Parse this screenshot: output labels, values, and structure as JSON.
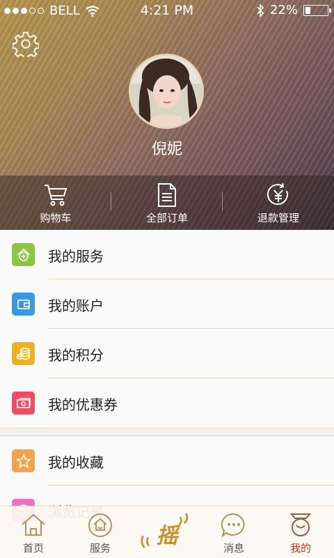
{
  "status_bar": {
    "carrier": "BELL",
    "time": "4:21 PM",
    "battery": "22%",
    "battery_level": 0.22
  },
  "profile": {
    "name": "倪妮"
  },
  "quick_actions": [
    {
      "label": "购物车",
      "icon": "cart-icon"
    },
    {
      "label": "全部订单",
      "icon": "order-list-icon"
    },
    {
      "label": "退款管理",
      "icon": "refund-yen-icon"
    }
  ],
  "menu": {
    "items": [
      {
        "label": "我的服务",
        "icon": "house-service-icon",
        "color": "#8cc63f"
      },
      {
        "label": "我的账户",
        "icon": "wallet-icon",
        "color": "#3a98e0"
      },
      {
        "label": "我的积分",
        "icon": "coins-icon",
        "color": "#f2b01e"
      },
      {
        "label": "我的优惠券",
        "icon": "coupon-icon",
        "color": "#f04d64"
      },
      {
        "label": "我的收藏",
        "icon": "star-icon",
        "color": "#f7a14a"
      },
      {
        "label": "浏览记录",
        "icon": "history-icon",
        "color": "#f06ec8"
      }
    ]
  },
  "tab_bar": {
    "tabs": [
      {
        "label": "首页",
        "icon": "home-icon"
      },
      {
        "label": "服务",
        "icon": "service-icon"
      },
      {
        "label": "摇",
        "icon": "shake-icon"
      },
      {
        "label": "消息",
        "icon": "message-icon"
      },
      {
        "label": "我的",
        "icon": "me-icon",
        "active": true
      }
    ]
  },
  "colors": {
    "accent": "#c0392b",
    "tab_icon": "#b8905a",
    "divider": "#ead9c2"
  }
}
